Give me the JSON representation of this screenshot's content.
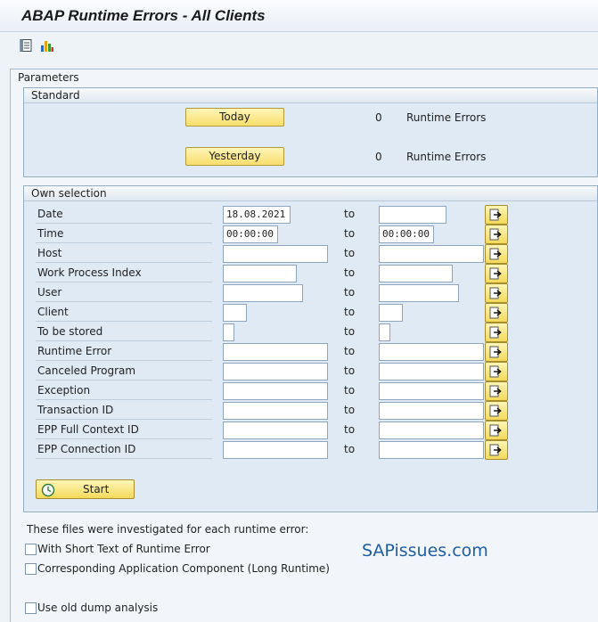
{
  "window": {
    "title": "ABAP Runtime Errors - All Clients"
  },
  "toolbar": {
    "icons": [
      "list-icon",
      "chart-icon"
    ]
  },
  "parameters": {
    "title": "Parameters"
  },
  "standard": {
    "title": "Standard",
    "today_label": "Today",
    "today_count": "0",
    "today_text": "Runtime Errors",
    "yesterday_label": "Yesterday",
    "yesterday_count": "0",
    "yesterday_text": "Runtime Errors"
  },
  "own_selection": {
    "title": "Own selection",
    "to_label": "to",
    "rows": [
      {
        "label": "Date",
        "from": "18.08.2021",
        "to": ""
      },
      {
        "label": "Time",
        "from": "00:00:00",
        "to": "00:00:00"
      },
      {
        "label": "Host",
        "from": "",
        "to": ""
      },
      {
        "label": "Work Process Index",
        "from": "",
        "to": ""
      },
      {
        "label": "User",
        "from": "",
        "to": ""
      },
      {
        "label": "Client",
        "from": "",
        "to": ""
      },
      {
        "label": "To be stored",
        "from": "",
        "to": ""
      },
      {
        "label": "Runtime Error",
        "from": "",
        "to": ""
      },
      {
        "label": "Canceled Program",
        "from": "",
        "to": ""
      },
      {
        "label": "Exception",
        "from": "",
        "to": ""
      },
      {
        "label": "Transaction ID",
        "from": "",
        "to": ""
      },
      {
        "label": "EPP Full Context ID",
        "from": "",
        "to": ""
      },
      {
        "label": "EPP Connection ID",
        "from": "",
        "to": ""
      }
    ],
    "start_label": "Start"
  },
  "files": {
    "heading": "These files were investigated for each runtime error:",
    "short_text_label": "With Short Text of Runtime Error",
    "short_text_checked": false,
    "component_label": "Corresponding Application Component (Long Runtime)",
    "component_checked": false,
    "old_dump_label": "Use old dump analysis",
    "old_dump_checked": false
  },
  "watermark": "SAPissues.com",
  "colors": {
    "button_yellow": "#f7dd6b",
    "group_bg": "#dfeaf4",
    "watermark": "#1e5ea3"
  }
}
